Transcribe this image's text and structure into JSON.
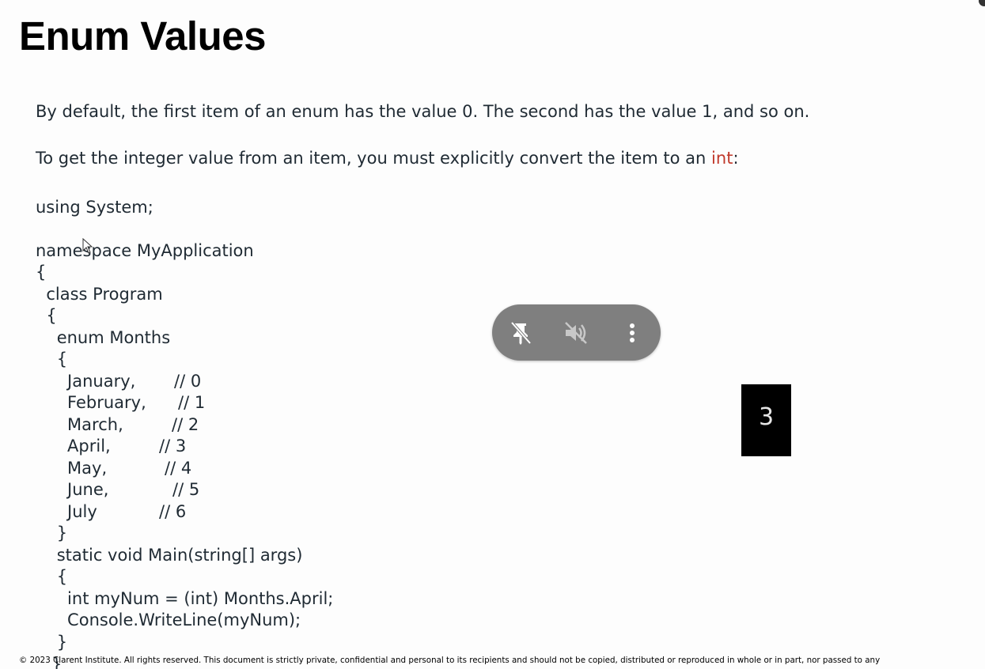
{
  "slide": {
    "title": "Enum Values",
    "para1": "By default, the first item of an enum has the value 0. The second has the value 1, and so on.",
    "para2_text": "To get the integer value from an item, you must explicitly convert the item to an ",
    "para2_keyword": "int",
    "para2_end": ":",
    "code": {
      "using": "using System;",
      "ns": "namespace MyApplication",
      "open1": "{",
      "class": "  class Program",
      "open2": "  {",
      "enum": "    enum Months",
      "open3": "    {",
      "months": [
        {
          "name": "      January,",
          "comment": "// 0"
        },
        {
          "name": "      February,",
          "comment": "// 1"
        },
        {
          "name": "      March,",
          "comment": "// 2"
        },
        {
          "name": "      April,",
          "comment": "// 3"
        },
        {
          "name": "      May,",
          "comment": "// 4"
        },
        {
          "name": "      June,",
          "comment": "// 5"
        },
        {
          "name": "      July",
          "comment": "// 6"
        }
      ],
      "close3": "    }",
      "main": "    static void Main(string[] args)",
      "open4": "    {",
      "stmt1": "      int myNum = (int) Months.April;",
      "stmt2": "      Console.WriteLine(myNum);",
      "close4": "    }",
      "close_partial": "}"
    },
    "output_value": "3",
    "footer": "© 2023 Clarent Institute. All rights reserved. This document is strictly private, confidential and personal to its recipients and should not be copied, distributed or reproduced in whole or in part, nor passed to any"
  },
  "video_controls": {
    "icons": [
      "unpin-icon",
      "volume-muted-icon",
      "more-vertical-icon"
    ]
  },
  "colors": {
    "keyword": "#c0392b",
    "pill_bg": "#7f7f7f",
    "output_bg": "#000000"
  }
}
